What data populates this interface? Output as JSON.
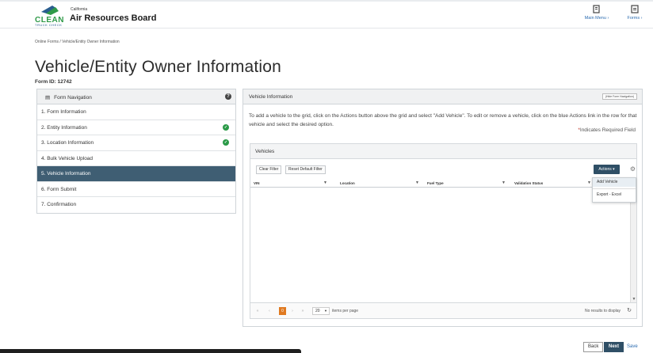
{
  "header": {
    "logo_state": "California",
    "logo_clean": "CLEAN",
    "logo_truck_check": "TRUCK CHECK",
    "logo_org": "Air Resources Board",
    "main_menu": "Main Menu",
    "forms_menu": "Forms"
  },
  "breadcrumb": "Online Forms / Vehicle/Entity Owner Information",
  "page_title": "Vehicle/Entity Owner Information",
  "form_id": "Form ID: 12742",
  "nav": {
    "title": "Form Navigation",
    "items": [
      {
        "label": "1. Form Information",
        "complete": false
      },
      {
        "label": "2. Entity Information",
        "complete": true
      },
      {
        "label": "3. Location Information",
        "complete": true
      },
      {
        "label": "4. Bulk Vehicle Upload",
        "complete": false
      },
      {
        "label": "5. Vehicle Information",
        "complete": false,
        "active": true
      },
      {
        "label": "6. Form Submit",
        "complete": false
      },
      {
        "label": "7. Confirmation",
        "complete": false
      }
    ]
  },
  "main": {
    "title": "Vehicle Information",
    "hide_nav_label": "(Hide Form Navigation)",
    "instructions": "To add a vehicle to the grid, click on the Actions button above the grid and select \"Add Vehicle\". To edit or remove a vehicle, click on the blue Actions link in the row for that vehicle and select the desired option.",
    "required_note": "Indicates Required Field",
    "required_star": "*"
  },
  "vehicles": {
    "title": "Vehicles",
    "clear_filter": "Clear Filter",
    "reset_filter": "Reset Default Filter",
    "actions_label": "Actions ▾",
    "columns": [
      "VIN",
      "Location",
      "Fuel Type",
      "Validation Status"
    ],
    "actions_menu": [
      "Add Vehicle",
      "Export - Excel"
    ]
  },
  "pager": {
    "current_page": "0",
    "page_size": "20",
    "page_size_label": "items per page",
    "no_results": "No results to display"
  },
  "footer": {
    "back": "Back",
    "next": "Next",
    "save": "Save"
  },
  "colors": {
    "nav_active": "#3f5e73",
    "primary_button": "#2f4f66",
    "success": "#2a9a47",
    "pager_current": "#e07a21",
    "link": "#2a6bb0"
  }
}
